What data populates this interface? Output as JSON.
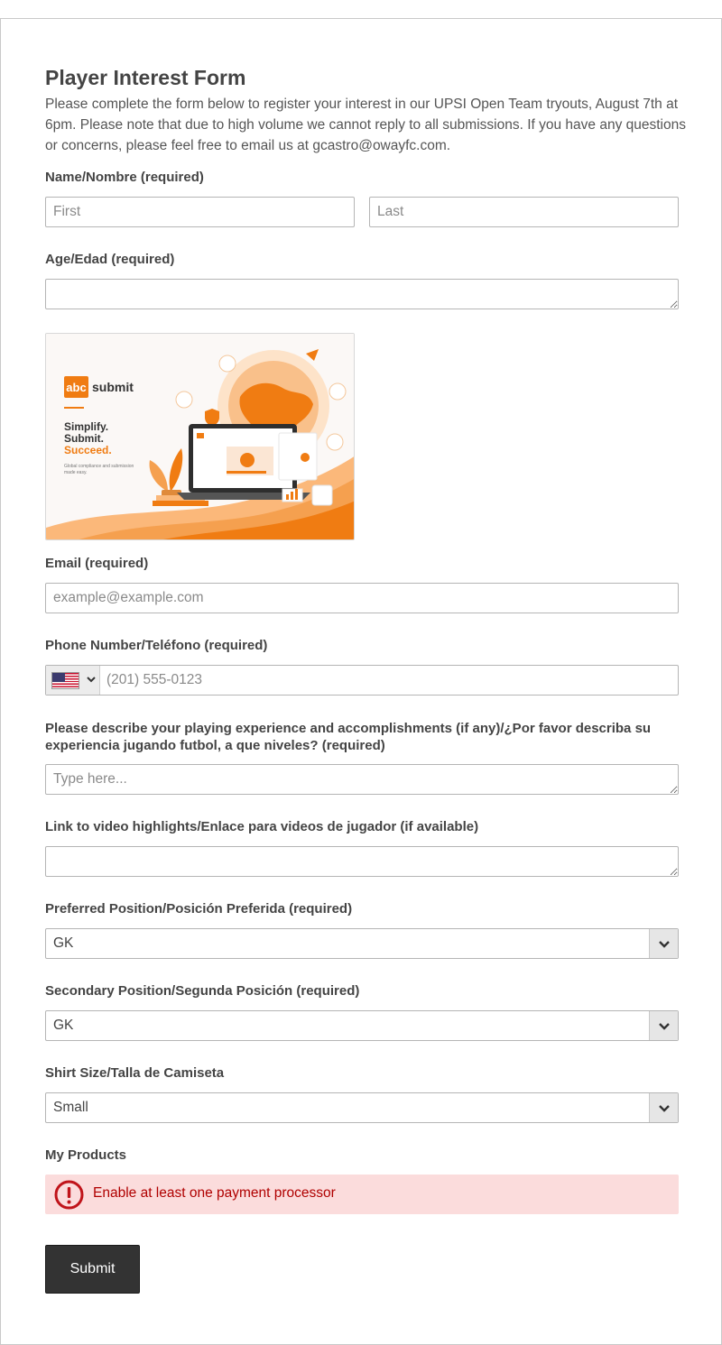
{
  "form": {
    "title": "Player Interest Form",
    "description": "Please complete the form below to register your interest in our UPSI Open Team tryouts, August 7th at 6pm. Please note that due to high volume we cannot reply to all submissions. If you have any questions or concerns, please feel free to email us at gcastro@owayfc.com."
  },
  "fields": {
    "name": {
      "label": "Name/Nombre (required)",
      "first_placeholder": "First",
      "last_placeholder": "Last"
    },
    "age": {
      "label": "Age/Edad (required)",
      "value": ""
    },
    "email": {
      "label": "Email (required)",
      "placeholder": "example@example.com"
    },
    "phone": {
      "label": "Phone Number/Teléfono (required)",
      "placeholder": "(201) 555-0123",
      "country_icon": "us-flag-icon"
    },
    "experience": {
      "label": "Please describe your playing experience and accomplishments (if any)/¿Por favor describa su experiencia jugando futbol, a que niveles? (required)",
      "placeholder": "Type here..."
    },
    "video": {
      "label": "Link to video highlights/Enlace para videos de jugador (if available)",
      "value": ""
    },
    "preferred_position": {
      "label": "Preferred Position/Posición Preferida (required)",
      "value": "GK"
    },
    "secondary_position": {
      "label": "Secondary Position/Segunda Posición (required)",
      "value": "GK"
    },
    "shirt_size": {
      "label": "Shirt Size/Talla de Camiseta",
      "value": "Small"
    },
    "products": {
      "label": "My Products",
      "alert": "Enable at least one payment processor"
    }
  },
  "ad": {
    "brand_tag": "abc",
    "brand_name": "submit",
    "tagline_1": "Simplify.",
    "tagline_2": "Submit.",
    "tagline_3": "Succeed.",
    "small_text_1": "Global compliance and submission",
    "small_text_2": "made easy.",
    "accent_color": "#f07c12"
  },
  "actions": {
    "submit_label": "Submit"
  },
  "colors": {
    "alert_bg": "#fbdcdc",
    "alert_text": "#b00000",
    "button_bg": "#333333"
  }
}
